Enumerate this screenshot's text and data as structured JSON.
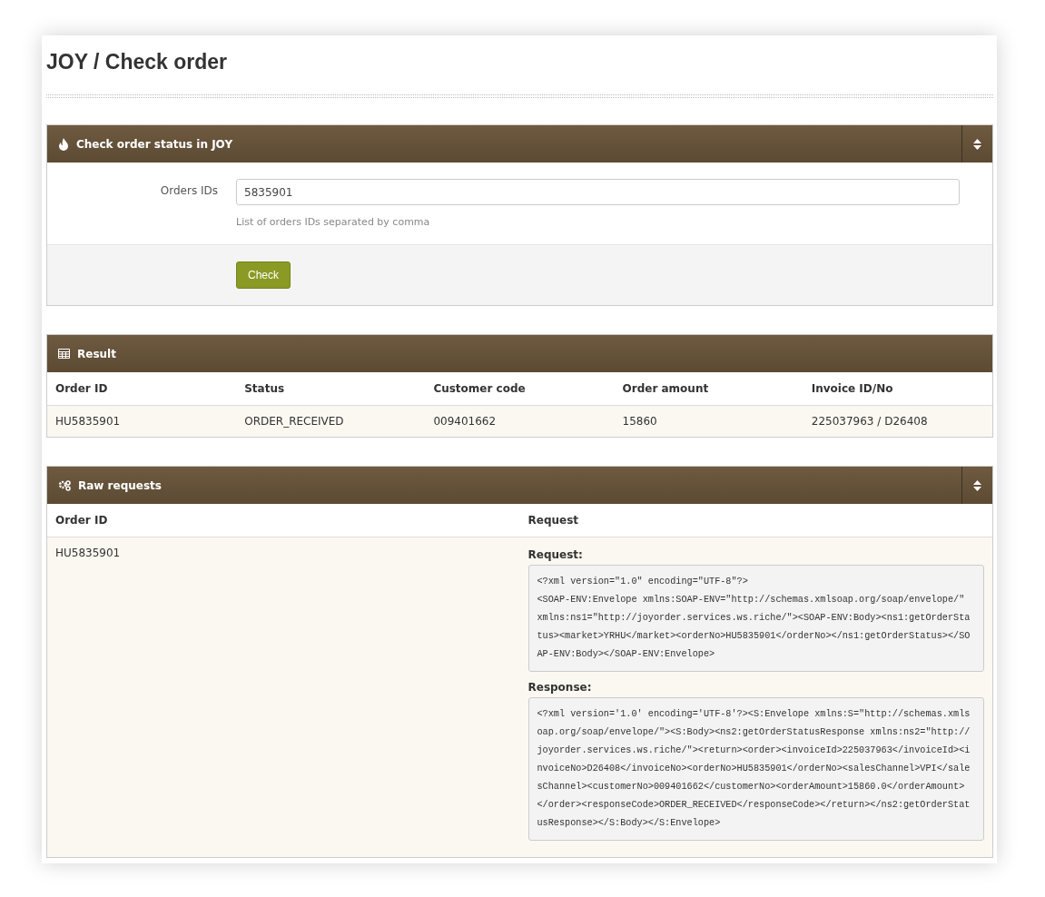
{
  "page_title": "JOY / Check order",
  "check_panel": {
    "title": "Check order status in JOY",
    "field_label": "Orders IDs",
    "field_value": "5835901",
    "help_text": "List of orders IDs separated by comma",
    "button": "Check"
  },
  "result_panel": {
    "title": "Result",
    "columns": [
      "Order ID",
      "Status",
      "Customer code",
      "Order amount",
      "Invoice ID/No"
    ],
    "rows": [
      [
        "HU5835901",
        "ORDER_RECEIVED",
        "009401662",
        "15860",
        "225037963 / D26408"
      ]
    ]
  },
  "raw_panel": {
    "title": "Raw requests",
    "columns": [
      "Order ID",
      "Request"
    ],
    "rows": [
      {
        "order_id": "HU5835901",
        "request_label": "Request:",
        "request": "<?xml version=\"1.0\" encoding=\"UTF-8\"?>\n<SOAP-ENV:Envelope xmlns:SOAP-ENV=\"http://schemas.xmlsoap.org/soap/envelope/\" xmlns:ns1=\"http://joyorder.services.ws.riche/\"><SOAP-ENV:Body><ns1:getOrderStatus><market>YRHU</market><orderNo>HU5835901</orderNo></ns1:getOrderStatus></SOAP-ENV:Body></SOAP-ENV:Envelope>",
        "response_label": "Response:",
        "response": "<?xml version='1.0' encoding='UTF-8'?><S:Envelope xmlns:S=\"http://schemas.xmlsoap.org/soap/envelope/\"><S:Body><ns2:getOrderStatusResponse xmlns:ns2=\"http://joyorder.services.ws.riche/\"><return><order><invoiceId>225037963</invoiceId><invoiceNo>D26408</invoiceNo><orderNo>HU5835901</orderNo><salesChannel>VPI</salesChannel><customerNo>009401662</customerNo><orderAmount>15860.0</orderAmount></order><responseCode>ORDER_RECEIVED</responseCode></return></ns2:getOrderStatusResponse></S:Body></S:Envelope>"
      }
    ]
  }
}
